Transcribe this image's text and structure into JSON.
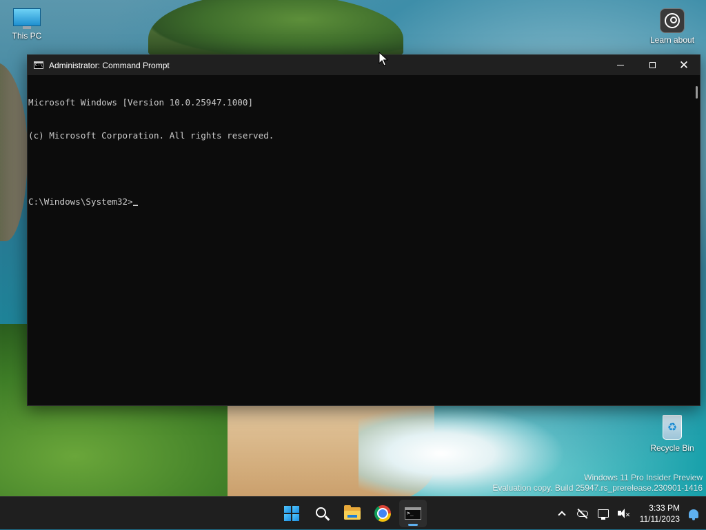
{
  "desktop": {
    "icons": [
      {
        "label": "This PC"
      },
      {
        "label": "Learn about"
      },
      {
        "label": "Recycle Bin"
      }
    ],
    "watermark": {
      "line1": "Windows 11 Pro Insider Preview",
      "line2": "Evaluation copy. Build 25947.rs_prerelease.230901-1416"
    }
  },
  "cmd_window": {
    "title": "Administrator: Command Prompt",
    "console_lines": [
      "Microsoft Windows [Version 10.0.25947.1000]",
      "(c) Microsoft Corporation. All rights reserved.",
      "",
      "C:\\Windows\\System32>"
    ]
  },
  "taskbar": {
    "apps": [
      "start-icon",
      "search-icon",
      "file-explorer-icon",
      "chrome-icon",
      "command-prompt-icon"
    ],
    "active_app": "command-prompt-icon",
    "clock": {
      "time": "3:33 PM",
      "date": "11/11/2023"
    }
  },
  "colors": {
    "console_bg": "#0c0c0c",
    "console_text": "#cccccc",
    "titlebar_bg": "#202020",
    "taskbar_bg": "#1f1f1f",
    "accent": "#5eb0ef"
  }
}
